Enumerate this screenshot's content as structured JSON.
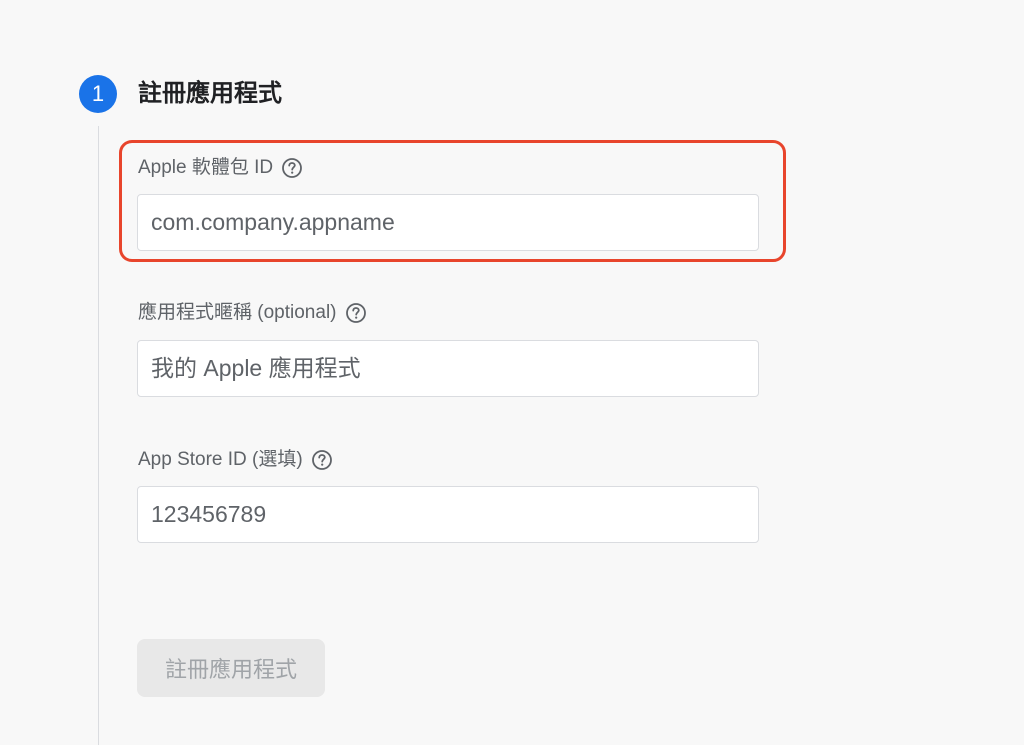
{
  "step": {
    "number": "1",
    "title": "註冊應用程式"
  },
  "fields": [
    {
      "label": "Apple 軟體包 ID",
      "placeholder": "com.company.appname",
      "help_icon": "help-circle-icon"
    },
    {
      "label": "應用程式暱稱 (optional)",
      "placeholder": "我的 Apple 應用程式",
      "help_icon": "help-circle-icon"
    },
    {
      "label": "App Store ID (選填)",
      "placeholder": "123456789",
      "help_icon": "help-circle-icon"
    }
  ],
  "register_button": {
    "label": "註冊應用程式",
    "disabled": true
  },
  "colors": {
    "accent": "#1a73e8",
    "highlight": "#e8452c",
    "background": "#f8f8f8"
  }
}
